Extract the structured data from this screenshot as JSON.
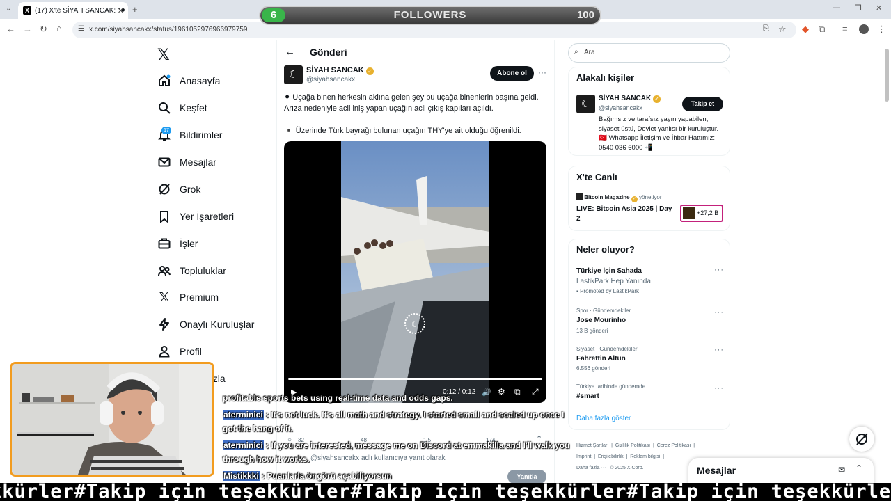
{
  "browser": {
    "tab_title": "(17) X'te SİYAH SANCAK: \"⚫ U",
    "url": "x.com/siyahsancakx/status/1961052976966979759"
  },
  "overlay": {
    "followers_current": "6",
    "followers_label": "FOLLOWERS",
    "followers_goal": "100",
    "followers_progress": 0.06,
    "ticker": "kkürler#Takip için teşekkürler#Takip için teşekkürler#Takip için teşekkürler"
  },
  "nav": {
    "items": [
      {
        "label": "Anasayfa",
        "icon": "home-icon"
      },
      {
        "label": "Keşfet",
        "icon": "search-icon"
      },
      {
        "label": "Bildirimler",
        "icon": "bell-icon"
      },
      {
        "label": "Mesajlar",
        "icon": "mail-icon"
      },
      {
        "label": "Grok",
        "icon": "grok-icon"
      },
      {
        "label": "Yer İşaretleri",
        "icon": "bookmark-icon"
      },
      {
        "label": "İşler",
        "icon": "briefcase-icon"
      },
      {
        "label": "Topluluklar",
        "icon": "people-icon"
      },
      {
        "label": "Premium",
        "icon": "x-icon"
      },
      {
        "label": "Onaylı Kuruluşlar",
        "icon": "lightning-icon"
      },
      {
        "label": "Profil",
        "icon": "person-icon"
      },
      {
        "label": "azla",
        "icon": "more-icon"
      }
    ],
    "notifications_badge": "17"
  },
  "post": {
    "header_title": "Gönderi",
    "author_name": "SİYAH SANCAK",
    "author_handle": "@siyahsancakx",
    "follow_label": "Abone ol",
    "text_line1": "⚫ Uçağa binen herkesin aklına gelen şey bu uçağa binenlerin başına geldi. Arıza nedeniyle acil iniş yapan uçağın acil çıkış kapıları açıldı.",
    "text_line2": "▪️ Üzerinde Türk bayrağı bulunan uçağın THY'ye ait olduğu öğrenildi.",
    "video_time": "0:12 / 0:12",
    "video_progress": 1.0,
    "reply_context": "siyahsancakx adlı kullanıcıya yanıt olarak",
    "reply_button": "Yanıtla",
    "stat_replies": "32",
    "stat_reposts": "48",
    "stat_likes": "1,5",
    "stat_views": "174"
  },
  "search": {
    "placeholder": "Ara"
  },
  "relevant": {
    "title": "Alakalı kişiler",
    "name": "SİYAH SANCAK",
    "handle": "@siyahsancakx",
    "follow_label": "Takip et",
    "bio": "Bağımsız ve tarafsız yayın yapabilen, siyaset üstü, Devlet yanlısı bir kuruluştur. 🇹🇷 Whatsapp İletişim ve İhbar Hattımız: 0540 036 6000 📲"
  },
  "live": {
    "title": "X'te Canlı",
    "host": "Bitcoin Magazine",
    "host_suffix": "yönetiyor",
    "event": "LIVE: Bitcoin Asia 2025 | Day 2",
    "listeners": "+27,2 B"
  },
  "trends": {
    "title": "Neler oluyor?",
    "items": [
      {
        "meta": "",
        "name": "Türkiye İçin Sahada",
        "sub": "LastikPark Hep Yanında",
        "extra": "Promoted by LastikPark"
      },
      {
        "meta": "Spor · Gündemdekiler",
        "name": "Jose Mourinho",
        "sub": "13 B gönderi",
        "extra": ""
      },
      {
        "meta": "Siyaset · Gündemdekiler",
        "name": "Fahrettin Altun",
        "sub": "6.556 gönderi",
        "extra": ""
      },
      {
        "meta": "Türkiye tarihinde gündemde",
        "name": "#smart",
        "sub": "",
        "extra": ""
      }
    ],
    "show_more": "Daha fazla göster"
  },
  "footer": {
    "links": [
      "Hizmet Şartları",
      "Gizlilik Politikası",
      "Çerez Politikası",
      "Imprint",
      "Erişilebilirlik",
      "Reklam bilgisi",
      "Daha fazla ···",
      "© 2025 X Corp."
    ]
  },
  "messages_drawer": {
    "title": "Mesajlar"
  },
  "chat": [
    {
      "user": "",
      "text": "profitable sports bets using real-time data and odds gaps."
    },
    {
      "user": "aterminici",
      "text": ": It's not luck. It's all math and strategy. I started small and scaled up once I"
    },
    {
      "user": "",
      "text": "got the hang of it."
    },
    {
      "user": "aterminici",
      "text": ": If you are interested, message me on Discord at emmakilla and I'll walk you"
    },
    {
      "user": "",
      "text": "through how it works."
    },
    {
      "user": "Mistikkki",
      "text": ": Puanlarla öngörü açabiliyorsun"
    }
  ],
  "colors": {
    "accent": "#1d9bf0",
    "verified": "#e8b12e",
    "followers_bar": "#39b54a",
    "webcam_border": "#f29c1f",
    "chat_user_bg": "#3d6cc4"
  }
}
